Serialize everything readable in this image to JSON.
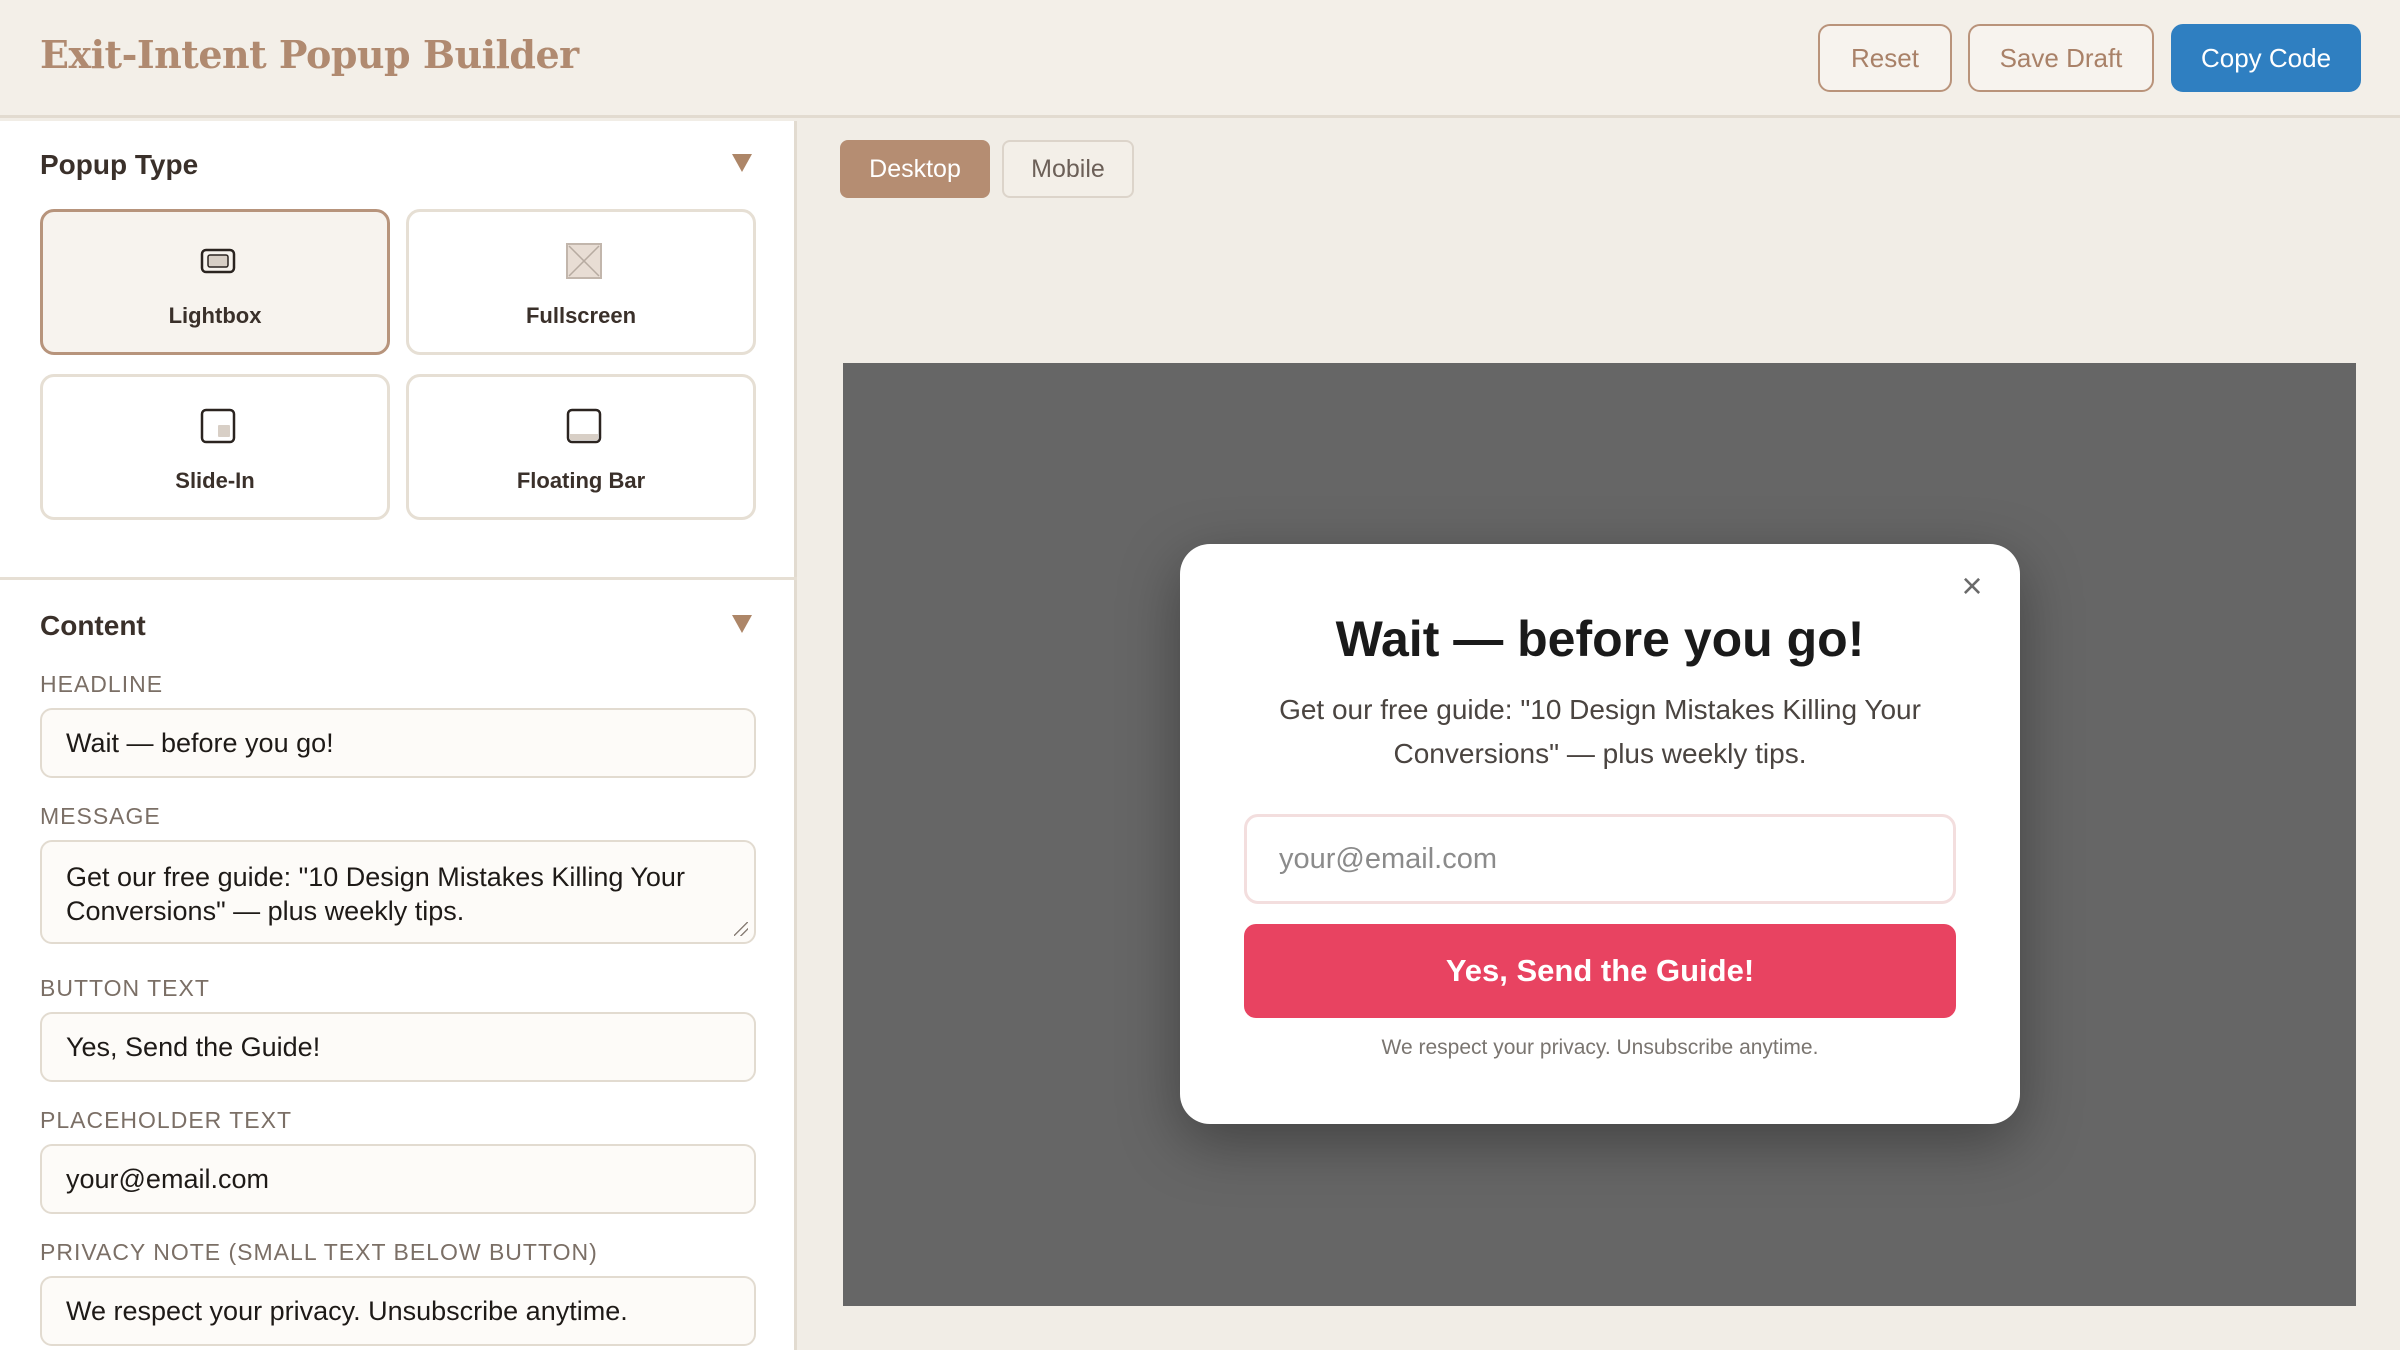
{
  "header": {
    "title": "Exit-Intent Popup Builder",
    "reset_label": "Reset",
    "save_draft_label": "Save Draft",
    "copy_code_label": "Copy Code"
  },
  "sidebar": {
    "popup_type": {
      "title": "Popup Type",
      "options": [
        {
          "label": "Lightbox",
          "icon": "lightbox-icon",
          "selected": true
        },
        {
          "label": "Fullscreen",
          "icon": "fullscreen-icon",
          "selected": false
        },
        {
          "label": "Slide-In",
          "icon": "slide-in-icon",
          "selected": false
        },
        {
          "label": "Floating Bar",
          "icon": "floating-bar-icon",
          "selected": false
        }
      ]
    },
    "content": {
      "title": "Content",
      "headline_label": "HEADLINE",
      "headline_value": "Wait — before you go!",
      "message_label": "MESSAGE",
      "message_value": "Get our free guide: \"10 Design Mistakes Killing Your Conversions\" — plus weekly tips.",
      "button_text_label": "BUTTON TEXT",
      "button_text_value": "Yes, Send the Guide!",
      "placeholder_label": "PLACEHOLDER TEXT",
      "placeholder_value": "your@email.com",
      "privacy_label": "PRIVACY NOTE (SMALL TEXT BELOW BUTTON)",
      "privacy_value": "We respect your privacy. Unsubscribe anytime."
    }
  },
  "preview": {
    "device_tabs": {
      "desktop": "Desktop",
      "mobile": "Mobile",
      "active": "desktop"
    },
    "popup": {
      "close_glyph": "×",
      "headline": "Wait — before you go!",
      "message": "Get our free guide: \"10 Design Mistakes Killing Your Conversions\" — plus weekly tips.",
      "email_placeholder": "your@email.com",
      "cta": "Yes, Send the Guide!",
      "privacy": "We respect your privacy. Unsubscribe anytime."
    }
  },
  "colors": {
    "accent_brown": "#b58d72",
    "copy_blue": "#2f7fc1",
    "cta_red": "#e84361",
    "overlay": "#666666"
  }
}
